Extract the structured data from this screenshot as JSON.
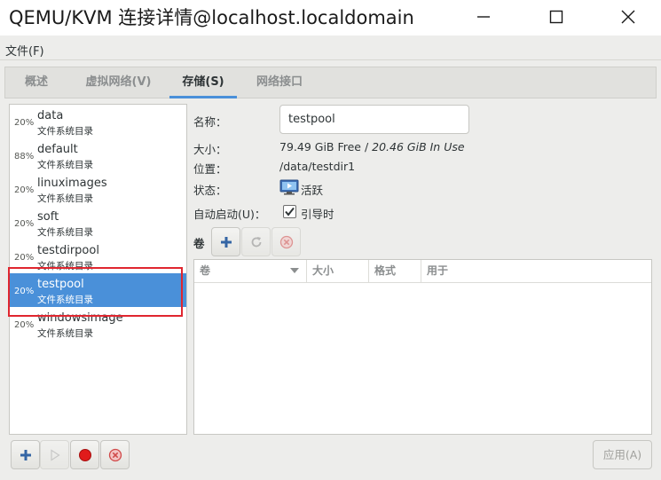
{
  "window": {
    "title": "QEMU/KVM 连接详情@localhost.localdomain"
  },
  "menubar": {
    "file": "文件(F)"
  },
  "tabs": [
    {
      "label": "概述"
    },
    {
      "label": "虚拟网络(V)"
    },
    {
      "label": "存储(S)"
    },
    {
      "label": "网络接口"
    }
  ],
  "pools": [
    {
      "pct": "20%",
      "name": "data",
      "type": "文件系统目录"
    },
    {
      "pct": "88%",
      "name": "default",
      "type": "文件系统目录"
    },
    {
      "pct": "20%",
      "name": "linuximages",
      "type": "文件系统目录"
    },
    {
      "pct": "20%",
      "name": "soft",
      "type": "文件系统目录"
    },
    {
      "pct": "20%",
      "name": "testdirpool",
      "type": "文件系统目录"
    },
    {
      "pct": "20%",
      "name": "testpool",
      "type": "文件系统目录"
    },
    {
      "pct": "20%",
      "name": "windowsimage",
      "type": "文件系统目录"
    }
  ],
  "details": {
    "name_label": "名称：",
    "name_value": "testpool",
    "size_label": "大小：",
    "size_free": "79.49 GiB Free / ",
    "size_used": "20.46 GiB In Use",
    "location_label": "位置：",
    "location_value": "/data/testdir1",
    "state_label": "状态：",
    "state_value": "活跃",
    "autostart_label": "自动启动(U)：",
    "autostart_value": "引导时"
  },
  "volumes": {
    "label": "卷",
    "columns": [
      "卷",
      "大小",
      "格式",
      "用于"
    ]
  },
  "buttons": {
    "apply": "应用(A)"
  }
}
